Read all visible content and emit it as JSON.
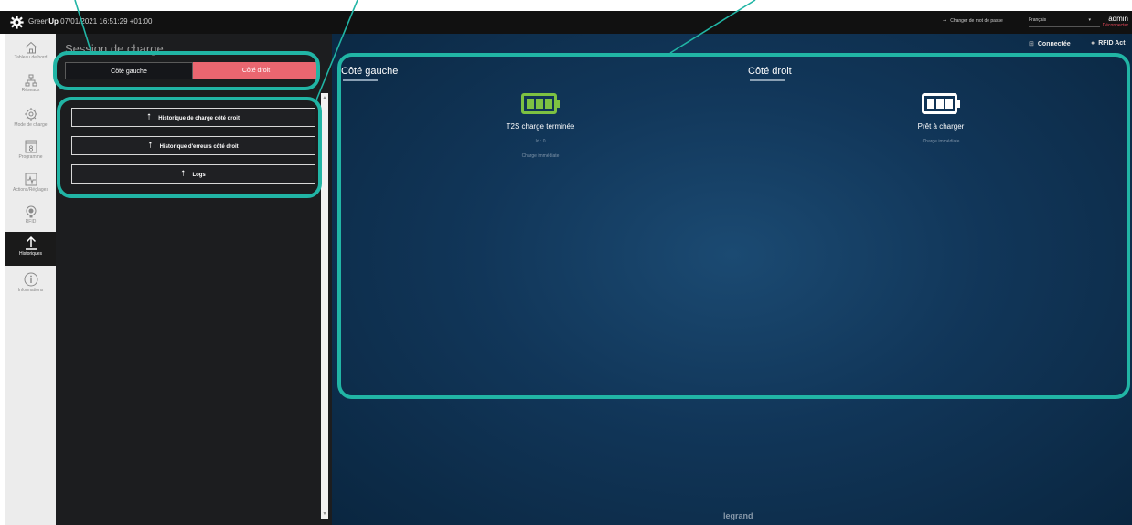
{
  "topbar": {
    "brand_prefix": "Green",
    "brand_bold": "Up",
    "datetime": " 07/01/2021 16:51:29 +01:00",
    "change_password": "Changer de mot de passe",
    "language": "Français",
    "user": "admin",
    "logout": "Déconnecter"
  },
  "nav": {
    "items": [
      {
        "label": "Tableau de bord",
        "icon": "home-icon"
      },
      {
        "label": "Réseaux",
        "icon": "network-icon"
      },
      {
        "label": "Mode de charge",
        "icon": "gear-icon"
      },
      {
        "label": "Programme",
        "icon": "calendar-icon",
        "badge": "8"
      },
      {
        "label": "Actions/Réglages",
        "icon": "settings-pulse-icon"
      },
      {
        "label": "RFID",
        "icon": "rfid-icon"
      },
      {
        "label": "Historiques",
        "icon": "upload-icon",
        "active": true
      },
      {
        "label": "Informations",
        "icon": "info-icon"
      }
    ]
  },
  "panel": {
    "title": "Session de charge",
    "seg_left": "Côté gauche",
    "seg_right": "Côté droit",
    "buttons": [
      "Historique de charge côté droit",
      "Historique d'erreurs côté droit",
      "Logs"
    ]
  },
  "main": {
    "connected": "Connectée",
    "rfid": "RFID Act",
    "left": {
      "title": "Côté gauche",
      "status": "T2S charge terminée",
      "id": "Id : 0",
      "mode": "Charge immédiate",
      "battery_color": "#7dc142"
    },
    "right": {
      "title": "Côté droit",
      "status": "Prêt à charger",
      "mode": "Charge immédiate",
      "battery_color": "#ffffff"
    },
    "footer": "legrand"
  },
  "colors": {
    "accent_teal": "#21b5a5",
    "segment_active": "#ea6670",
    "logout": "#e8485a"
  }
}
